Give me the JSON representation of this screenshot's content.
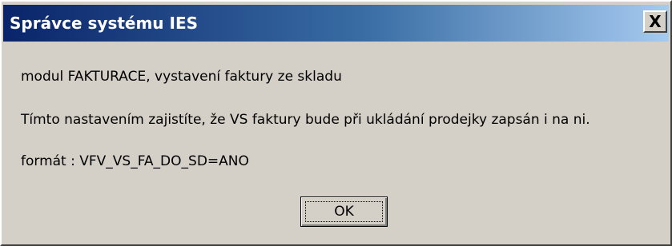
{
  "window": {
    "title": "Správce systému IES",
    "close_symbol": "X",
    "close_icon": "close-icon",
    "titlebar_colors": [
      "#0a246a",
      "#a6caf0"
    ],
    "face_color": "#d4d0c8"
  },
  "message": {
    "line1": "modul FAKTURACE, vystavení faktury ze skladu",
    "line2": "Tímto nastavením zajistíte, že VS faktury bude při ukládání prodejky zapsán i na ni.",
    "line3": "formát : VFV_VS_FA_DO_SD=ANO"
  },
  "buttons": {
    "ok_label": "OK"
  }
}
